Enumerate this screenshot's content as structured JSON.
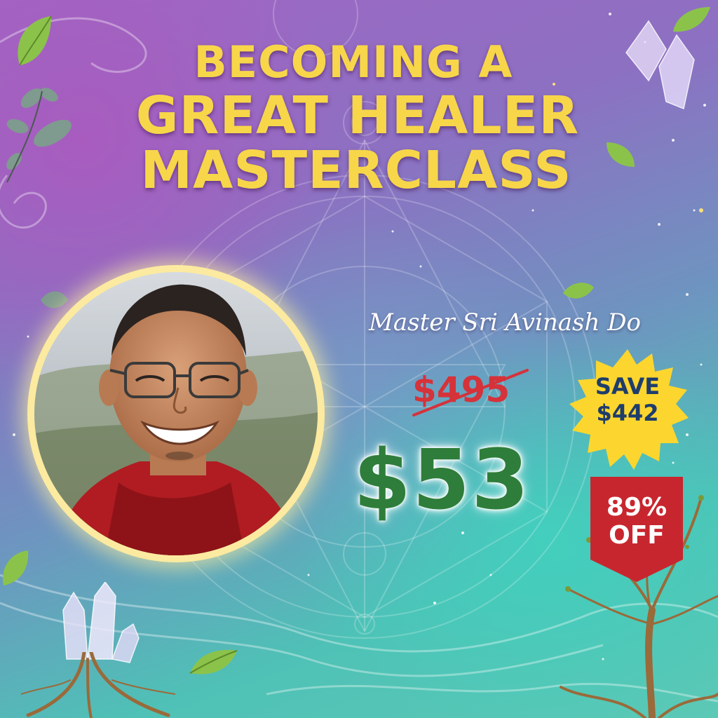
{
  "title": {
    "line1": "BECOMING A",
    "line2": "GREAT HEALER",
    "line3": "MASTERCLASS"
  },
  "teacher": {
    "name": "Master Sri Avinash Do"
  },
  "pricing": {
    "original_price": "$495",
    "sale_price": "$53",
    "save_line1": "SAVE",
    "save_line2": "$442",
    "discount_line1": "89%",
    "discount_line2": "OFF"
  },
  "colors": {
    "title": "#f7d64a",
    "old_price": "#d6323a",
    "sale_price": "#2e7d3a",
    "burst": "#fcd62e",
    "ribbon": "#c8262e"
  },
  "icons": [
    "leaf-icon",
    "crystal-icon",
    "tree-roots-icon",
    "sacred-geometry-icon"
  ]
}
